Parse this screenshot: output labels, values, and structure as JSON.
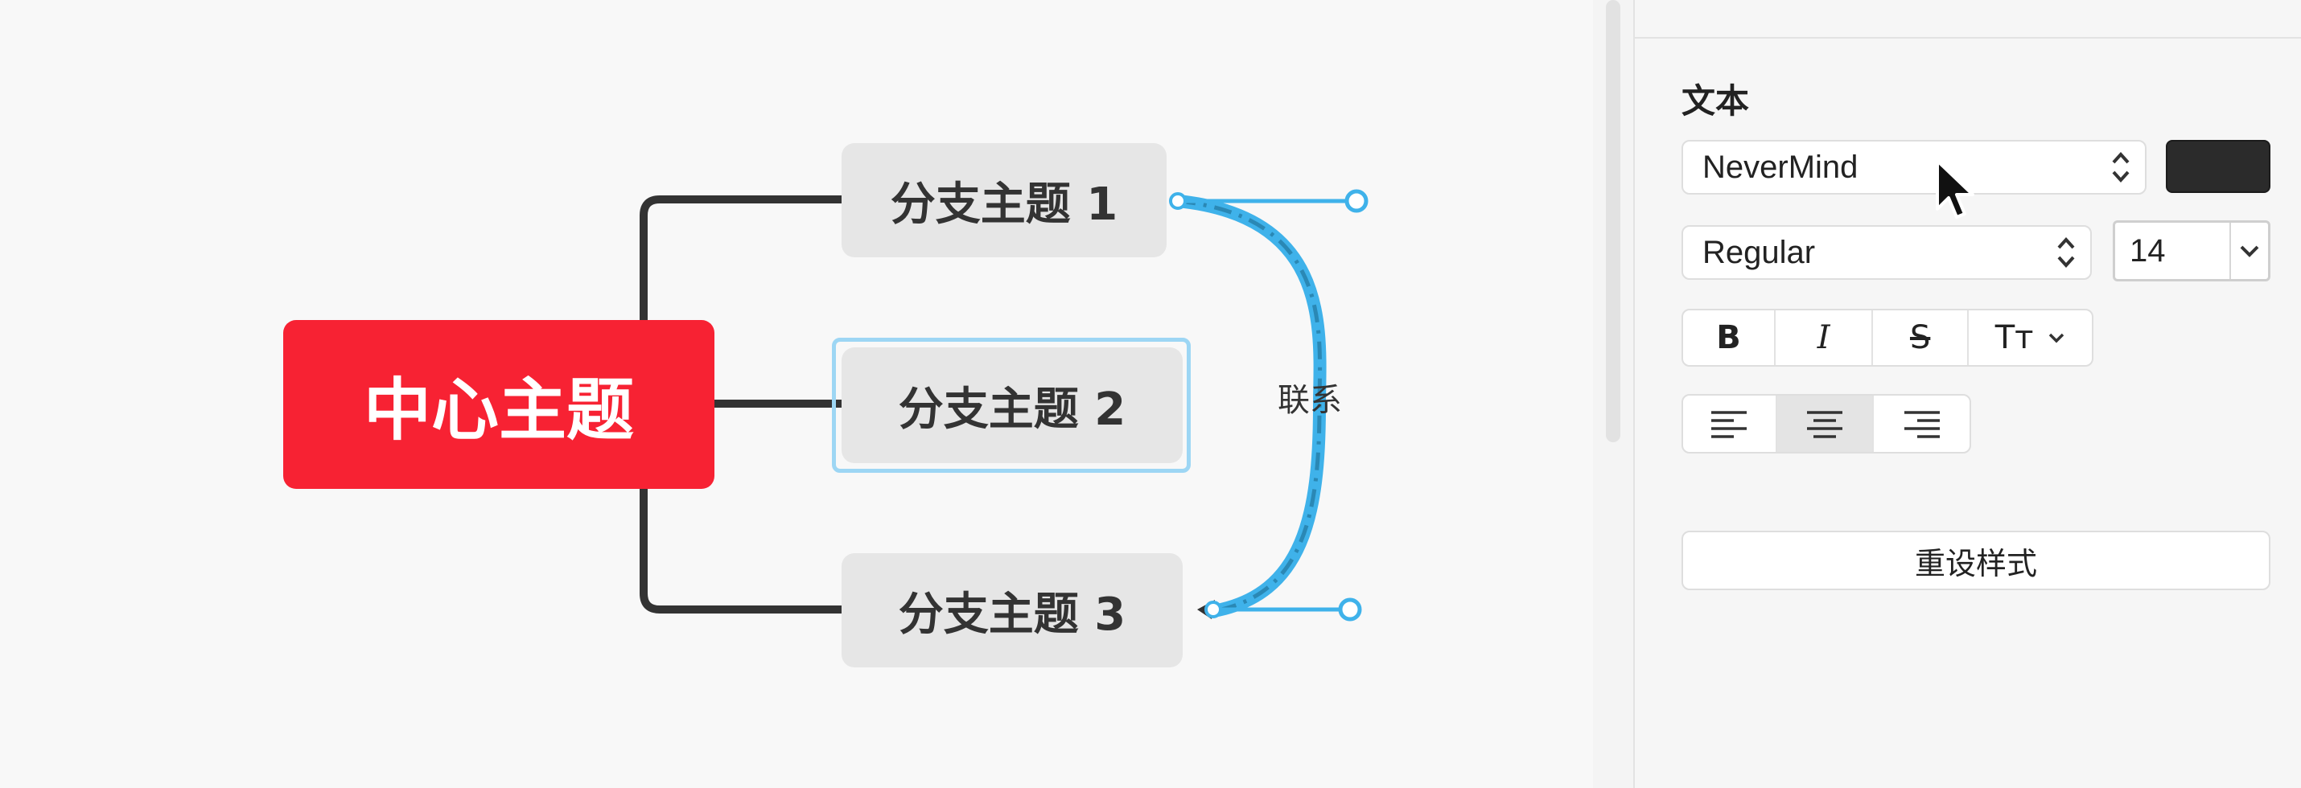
{
  "canvas": {
    "central_topic": "中心主题",
    "branches": [
      {
        "label": "分支主题 1"
      },
      {
        "label": "分支主题 2"
      },
      {
        "label": "分支主题 3"
      }
    ],
    "relationship_label": "联系",
    "selected_branch": "分支主题 2",
    "colors": {
      "central": "#f72233",
      "branch": "#e6e6e6",
      "connector": "#333333",
      "relationship": "#3fb2ea"
    }
  },
  "panel": {
    "section_title": "文本",
    "font_family": "NeverMind",
    "font_weight": "Regular",
    "font_size": "14",
    "text_color": "#2b2b2b",
    "style_buttons": [
      {
        "icon": "bold-icon",
        "label": "B"
      },
      {
        "icon": "italic-icon",
        "label": "I"
      },
      {
        "icon": "strikethrough-icon",
        "label": "S"
      },
      {
        "icon": "text-case-icon",
        "label": "Tт"
      }
    ],
    "align_buttons": [
      {
        "icon": "align-left-icon",
        "active": false
      },
      {
        "icon": "align-center-icon",
        "active": true
      },
      {
        "icon": "align-right-icon",
        "active": false
      }
    ],
    "reset_label": "重设样式"
  }
}
